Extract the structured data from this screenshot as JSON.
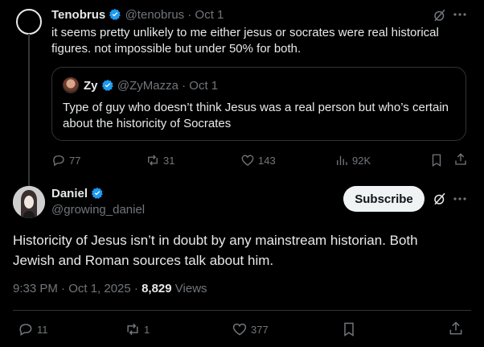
{
  "tweet1": {
    "author": "Tenobrus",
    "handle": "@tenobrus",
    "dot": "·",
    "date": "Oct 1",
    "text": "it seems pretty unlikely to me either jesus or socrates were real historical figures. not impossible but under 50% for both.",
    "quote": {
      "author": "Zy",
      "handle": "@ZyMazza",
      "dot": "·",
      "date": "Oct 1",
      "text": "Type of guy who doesn’t think Jesus was a real person but who’s certain about the historicity of Socrates"
    },
    "stats": {
      "replies": "77",
      "reposts": "31",
      "likes": "143",
      "views": "92K"
    }
  },
  "tweet2": {
    "author": "Daniel",
    "handle": "@growing_daniel",
    "subscribe_label": "Subscribe",
    "text": "Historicity of Jesus isn’t in doubt by any mainstream historian. Both Jewish and Roman sources talk about him.",
    "timestamp": "9:33 PM · Oct 1, 2025 ·",
    "view_count": "8,829",
    "views_label": "Views",
    "stats": {
      "replies": "11",
      "reposts": "1",
      "likes": "377"
    }
  },
  "colors": {
    "background": "#000000",
    "text": "#e7e9ea",
    "muted": "#71767b",
    "verified": "#1d9bf0",
    "border": "#2f3336"
  }
}
